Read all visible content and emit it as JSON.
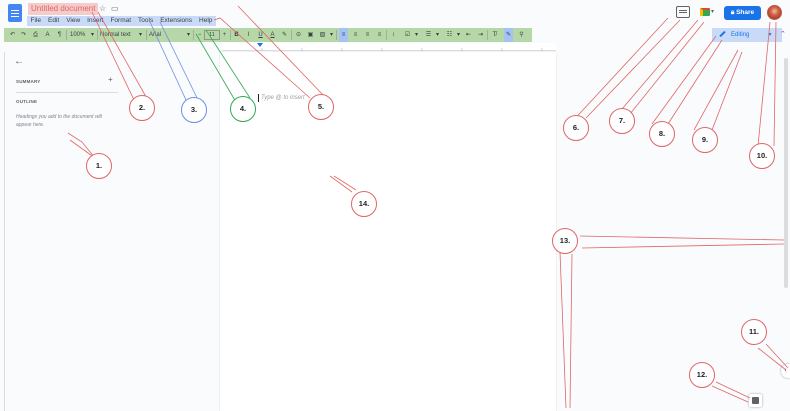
{
  "doc": {
    "title": "Untitled document",
    "menu": [
      "File",
      "Edit",
      "View",
      "Insert",
      "Format",
      "Tools",
      "Extensions",
      "Help"
    ]
  },
  "header": {
    "share_label": "Share",
    "editing_label": "Editing"
  },
  "toolbar": {
    "zoom": "100%",
    "style": "Normal text",
    "font": "Arial",
    "font_size": "11"
  },
  "sidebar": {
    "summary_label": "SUMMARY",
    "outline_label": "OUTLINE",
    "outline_hint": "Headings you add to the document will appear here."
  },
  "page": {
    "type_hint": "Type @ to insert"
  },
  "annotations": [
    "1.",
    "2.",
    "3.",
    "4.",
    "5.",
    "6.",
    "7.",
    "8.",
    "9.",
    "10.",
    "11.",
    "12.",
    "13.",
    "14."
  ],
  "colors": {
    "title_highlight": "#f4cccc",
    "menu_highlight": "#c9daf8",
    "toolbar_highlight": "#b6d7a8",
    "share_button": "#1a73e8",
    "callout_line": "#e06666"
  }
}
